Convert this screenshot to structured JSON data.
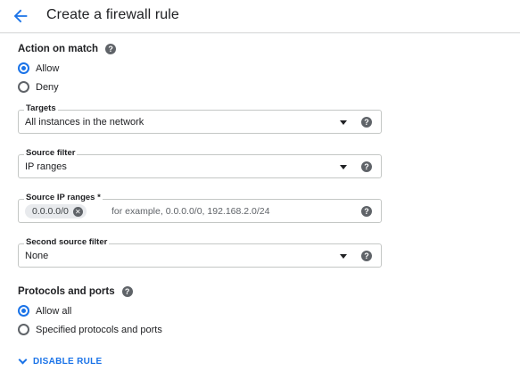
{
  "header": {
    "title": "Create a firewall rule",
    "back_icon": "arrow-left-icon"
  },
  "action_on_match": {
    "title": "Action on match",
    "options": [
      {
        "label": "Allow",
        "checked": true
      },
      {
        "label": "Deny",
        "checked": false
      }
    ]
  },
  "targets": {
    "label": "Targets",
    "value": "All instances in the network"
  },
  "source_filter": {
    "label": "Source filter",
    "value": "IP ranges"
  },
  "source_ip_ranges": {
    "label": "Source IP ranges *",
    "chip": "0.0.0.0/0",
    "placeholder": "for example, 0.0.0.0/0, 192.168.2.0/24"
  },
  "second_source_filter": {
    "label": "Second source filter",
    "value": "None"
  },
  "protocols_and_ports": {
    "title": "Protocols and ports",
    "options": [
      {
        "label": "Allow all",
        "checked": true
      },
      {
        "label": "Specified protocols and ports",
        "checked": false
      }
    ]
  },
  "disable_rule": {
    "label": "DISABLE RULE"
  },
  "help_glyph": "?",
  "colors": {
    "accent": "#1a73e8",
    "text": "#202124",
    "icon": "#5f6368"
  }
}
